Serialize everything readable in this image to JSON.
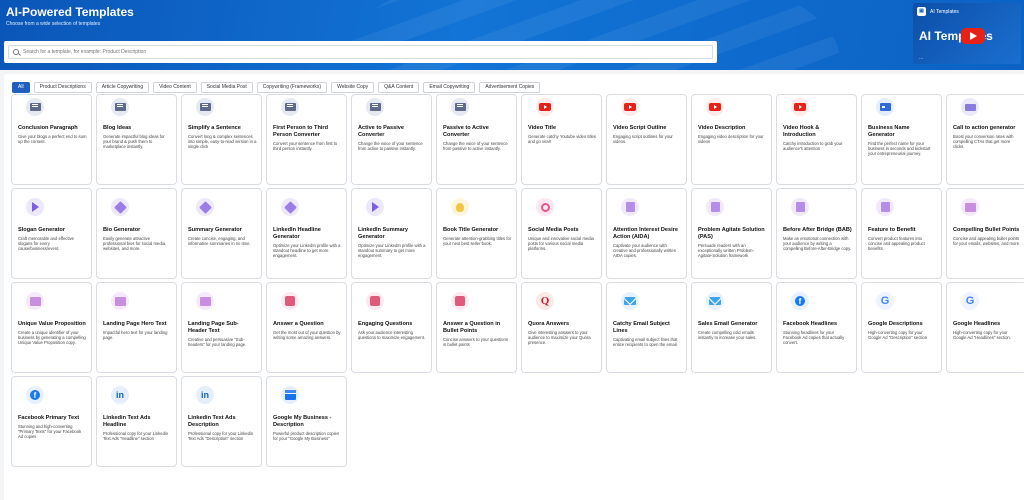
{
  "header": {
    "title": "AI-Powered Templates",
    "subtitle": "Choose from a wide selection of templates"
  },
  "search": {
    "placeholder": "Search for a template, for example: Product Description",
    "value": ""
  },
  "video": {
    "channel_label": "AI Templates",
    "big_title": "AI Templates",
    "dots": "..."
  },
  "tabs": [
    {
      "label": "All",
      "active": true
    },
    {
      "label": "Product Descriptions"
    },
    {
      "label": "Article Copywriting"
    },
    {
      "label": "Video Content"
    },
    {
      "label": "Social Media Post"
    },
    {
      "label": "Copywriting (Frameworks)"
    },
    {
      "label": "Website Copy"
    },
    {
      "label": "Q&A Content"
    },
    {
      "label": "Email Copywriting"
    },
    {
      "label": "Advertisement Copies"
    }
  ],
  "templates": [
    {
      "title": "Conclusion Paragraph",
      "desc": "Give your blogs a perfect end to sum up the content.",
      "icon": "chat-icon"
    },
    {
      "title": "Blog Ideas",
      "desc": "Generate impactful blog ideas for your brand & push them to marketplace instantly.",
      "icon": "chat-icon"
    },
    {
      "title": "Simplify a Sentence",
      "desc": "Convert long & complex sentences into simple, easy-to-read version in a single click",
      "icon": "chat-icon"
    },
    {
      "title": "First Person to Third Person Converter",
      "desc": "Convert your sentence from first to third person instantly.",
      "icon": "chat-icon"
    },
    {
      "title": "Active to Passive Converter",
      "desc": "Change the voice of your sentence from active to passive instantly.",
      "icon": "chat-icon"
    },
    {
      "title": "Passive to Active Converter",
      "desc": "Change the voice of your sentence from passive to active instantly.",
      "icon": "chat-icon"
    },
    {
      "title": "Video Title",
      "desc": "Generate catchy Youtube video titles and go viral!",
      "icon": "youtube-icon"
    },
    {
      "title": "Video Script Outline",
      "desc": "Engaging script outlines for your videos.",
      "icon": "youtube-icon"
    },
    {
      "title": "Video Description",
      "desc": "Engaging video description for your videos",
      "icon": "youtube-icon"
    },
    {
      "title": "Video Hook & Introduction",
      "desc": "Catchy introduction to grab your audience's attention",
      "icon": "youtube-icon"
    },
    {
      "title": "Business Name Generator",
      "desc": "Find the perfect name for your business in seconds and kickstart your entrepreneurial journey.",
      "icon": "business-card-icon"
    },
    {
      "title": "Call to action generator",
      "desc": "Boost your conversion rates with compelling CTAs that get more clicks.",
      "icon": "cta-icon"
    },
    {
      "title": "Slogan Generator",
      "desc": "Craft memorable and effective slogans for every cause/business/event.",
      "icon": "megaphone-icon"
    },
    {
      "title": "Bio Generator",
      "desc": "Easily generate attractive professional bios for social media, websites, and more.",
      "icon": "pen-icon"
    },
    {
      "title": "Summary Generator",
      "desc": "Create concise, engaging, and informative summaries in no time.",
      "icon": "pen-icon"
    },
    {
      "title": "LinkedIn Headline Generator",
      "desc": "Optimize your LinkedIn profile with a standout headline to get more engagement.",
      "icon": "pen-icon"
    },
    {
      "title": "LinkedIn Summary Generator",
      "desc": "Optimize your LinkedIn profile with a standout summary to get more engagement.",
      "icon": "megaphone-icon"
    },
    {
      "title": "Book Title Generator",
      "desc": "Generate attention-grabbing titles for your next best seller book.",
      "icon": "lightbulb-icon"
    },
    {
      "title": "Social Media Posts",
      "desc": "Unique and innovative social media posts for various social media platforms.",
      "icon": "social-ring-icon"
    },
    {
      "title": "Attention Interest Desire Action (AIDA)",
      "desc": "Captivate your audience with creative and professionally written AIDA copies.",
      "icon": "document-icon"
    },
    {
      "title": "Problem Agitate Solution (PAS)",
      "desc": "Persuade readers with an exceptionally written Problem-Agitate-Solution framework",
      "icon": "document-icon"
    },
    {
      "title": "Before After Bridge (BAB)",
      "desc": "Make an emotional connection with your audience by writing a compelling Before-After-Bridge copy.",
      "icon": "document-icon"
    },
    {
      "title": "Feature to Benefit",
      "desc": "Convert product features into concise and appealing product benefits.",
      "icon": "document-icon"
    },
    {
      "title": "Compelling Bullet Points",
      "desc": "Concise and appealing bullet points for your emails, websites, and more.",
      "icon": "image-icon"
    },
    {
      "title": "Unique Value Proposition",
      "desc": "Create a unique identifier of your business by generating a compelling Unique Value Proposition copy.",
      "icon": "image-icon"
    },
    {
      "title": "Landing Page Hero Text",
      "desc": "Impactful hero text for your landing page.",
      "icon": "image-icon"
    },
    {
      "title": "Landing Page Sub-Header Text",
      "desc": "Creative and persuasive \"Sub-headers\" for your landing page.",
      "icon": "image-icon"
    },
    {
      "title": "Answer a Question",
      "desc": "Get the most out of your question by writing some amazing answers.",
      "icon": "qa-icon"
    },
    {
      "title": "Engaging Questions",
      "desc": "Ask your audience interesting questions to maximize engagement.",
      "icon": "qa-icon"
    },
    {
      "title": "Answer a Question in Bullet Points",
      "desc": "Concise answers to your questions in bullet points",
      "icon": "qa-icon"
    },
    {
      "title": "Quora Answers",
      "desc": "Give interesting answers to your audience to maximize your Quora presence.",
      "icon": "quora-icon"
    },
    {
      "title": "Catchy Email Subject Lines",
      "desc": "Captivating email subject lines that entice recipients to open the email.",
      "icon": "mail-icon"
    },
    {
      "title": "Sales Email Generator",
      "desc": "Create compelling cold emails instantly to increase your sales.",
      "icon": "mail-icon"
    },
    {
      "title": "Facebook Headlines",
      "desc": "Stunning headlines for your Facebook Ad copies that actually convert.",
      "icon": "facebook-icon"
    },
    {
      "title": "Google Descriptions",
      "desc": "High-converting copy for your Google Ad \"Description\" section",
      "icon": "google-icon"
    },
    {
      "title": "Google Headlines",
      "desc": "High-converting copy for your Google Ad \"Headlines\" section.",
      "icon": "google-icon"
    },
    {
      "title": "Facebook Primary Text",
      "desc": "Stunning and high-converting \"Primary Texts\" for your Facebook Ad copies",
      "icon": "facebook-icon"
    },
    {
      "title": "Linkedin Text Ads Headline",
      "desc": "Professional copy for your Linkedin Text Ads \"Headline\" section",
      "icon": "linkedin-icon"
    },
    {
      "title": "Linkedin Text Ads Description",
      "desc": "Professional copy for your Linkedin Text Ads \"Description\" section",
      "icon": "linkedin-icon"
    },
    {
      "title": "Google My Business - Description",
      "desc": "Powerful product description copies for your \"Google My Business\"",
      "icon": "google-my-business-icon"
    }
  ],
  "colors": {
    "hero": "#1274d6",
    "tab_active": "#1f5fbf"
  }
}
